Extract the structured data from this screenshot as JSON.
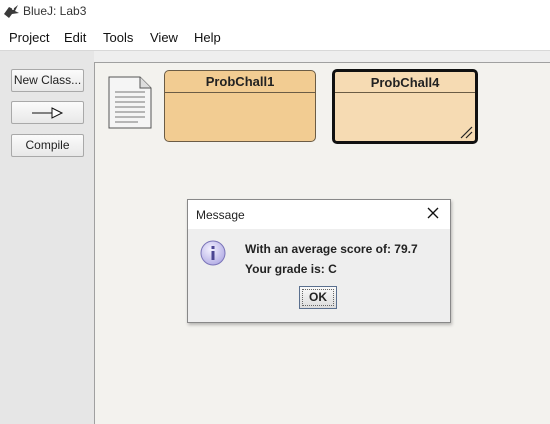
{
  "window": {
    "title": "BlueJ:  Lab3"
  },
  "menu": [
    "Project",
    "Edit",
    "Tools",
    "View",
    "Help"
  ],
  "sidebar": {
    "new_class": "New Class...",
    "compile": "Compile"
  },
  "classes": [
    {
      "name": "ProbChall1",
      "selected": false
    },
    {
      "name": "ProbChall4",
      "selected": true
    }
  ],
  "dialog": {
    "title": "Message",
    "line1": "With an average score of: 79.7",
    "line2": "Your grade is: C",
    "ok": "OK"
  },
  "colors": {
    "class_fill": "#f2cc92",
    "class_fill_selected": "#f6dbb3",
    "canvas": "#f3f2ee"
  }
}
